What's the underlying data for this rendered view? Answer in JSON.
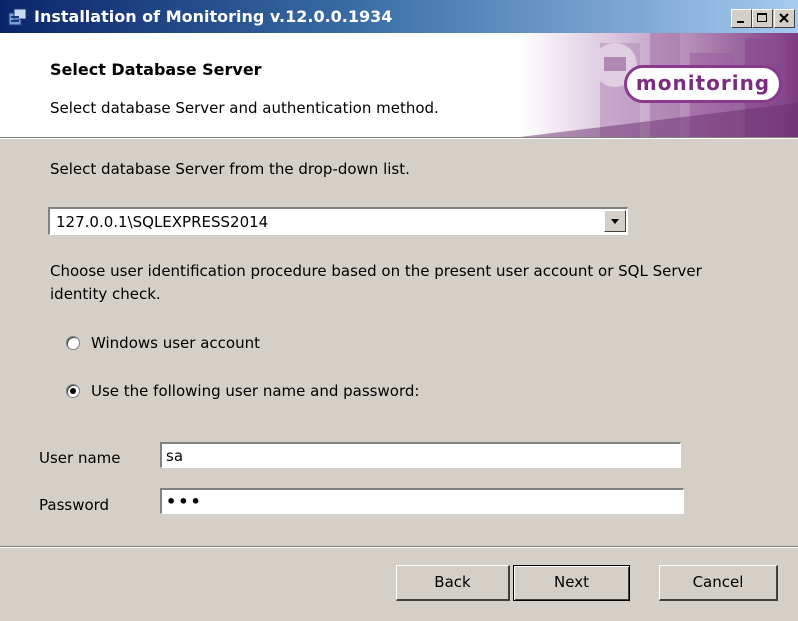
{
  "window": {
    "title": "Installation of Monitoring v.12.0.0.1934",
    "controls": [
      "minimize-icon",
      "maximize-icon",
      "close-icon"
    ]
  },
  "banner": {
    "title": "Select Database Server",
    "subtitle": "Select database Server and authentication method.",
    "logo_text": "monitoring",
    "accent_color": "#8a3a8c"
  },
  "form": {
    "server_prompt": "Select database Server from the drop-down list.",
    "server_value": "127.0.0.1\\SQLEXPRESS2014",
    "auth_prompt_line1": "Choose user identification procedure based on the present user account or SQL Server",
    "auth_prompt_line2": "identity check.",
    "radio_windows_label": "Windows user account",
    "radio_sql_label": "Use the following user name and password:",
    "selected_auth": "sql",
    "username_label": "User name",
    "username_value": "sa",
    "password_label": "Password",
    "password_mask": "•••"
  },
  "buttons": {
    "back": "Back",
    "next": "Next",
    "cancel": "Cancel"
  }
}
